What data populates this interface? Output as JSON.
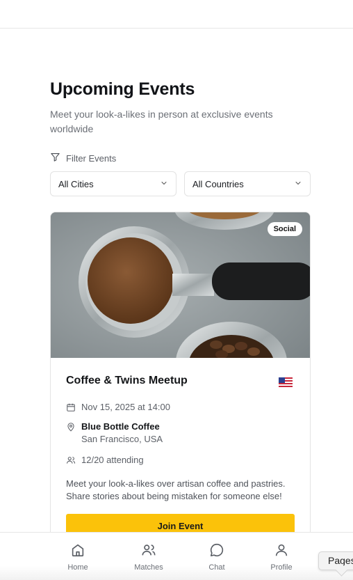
{
  "header": {
    "title": "Upcoming Events",
    "subtitle": "Meet your look-a-likes in person at exclusive events worldwide"
  },
  "filters": {
    "label": "Filter Events",
    "city_value": "All Cities",
    "country_value": "All Countries"
  },
  "event": {
    "badge": "Social",
    "title": "Coffee & Twins Meetup",
    "flag_icon": "us-flag-icon",
    "date": "Nov 15, 2025 at 14:00",
    "venue": "Blue Bottle Coffee",
    "location": "San Francisco, USA",
    "attending": "12/20 attending",
    "description": "Meet your look-a-likes over artisan coffee and pastries. Share stories about being mistaken for someone else!",
    "join_label": "Join Event"
  },
  "nav": {
    "items": [
      {
        "label": "Home",
        "icon": "home-icon"
      },
      {
        "label": "Matches",
        "icon": "users-icon"
      },
      {
        "label": "Chat",
        "icon": "chat-icon"
      },
      {
        "label": "Profile",
        "icon": "user-icon"
      }
    ]
  },
  "tooltip": {
    "label": "Pages"
  },
  "colors": {
    "accent": "#fbc20a",
    "text": "#111418",
    "muted": "#6b6f76"
  }
}
